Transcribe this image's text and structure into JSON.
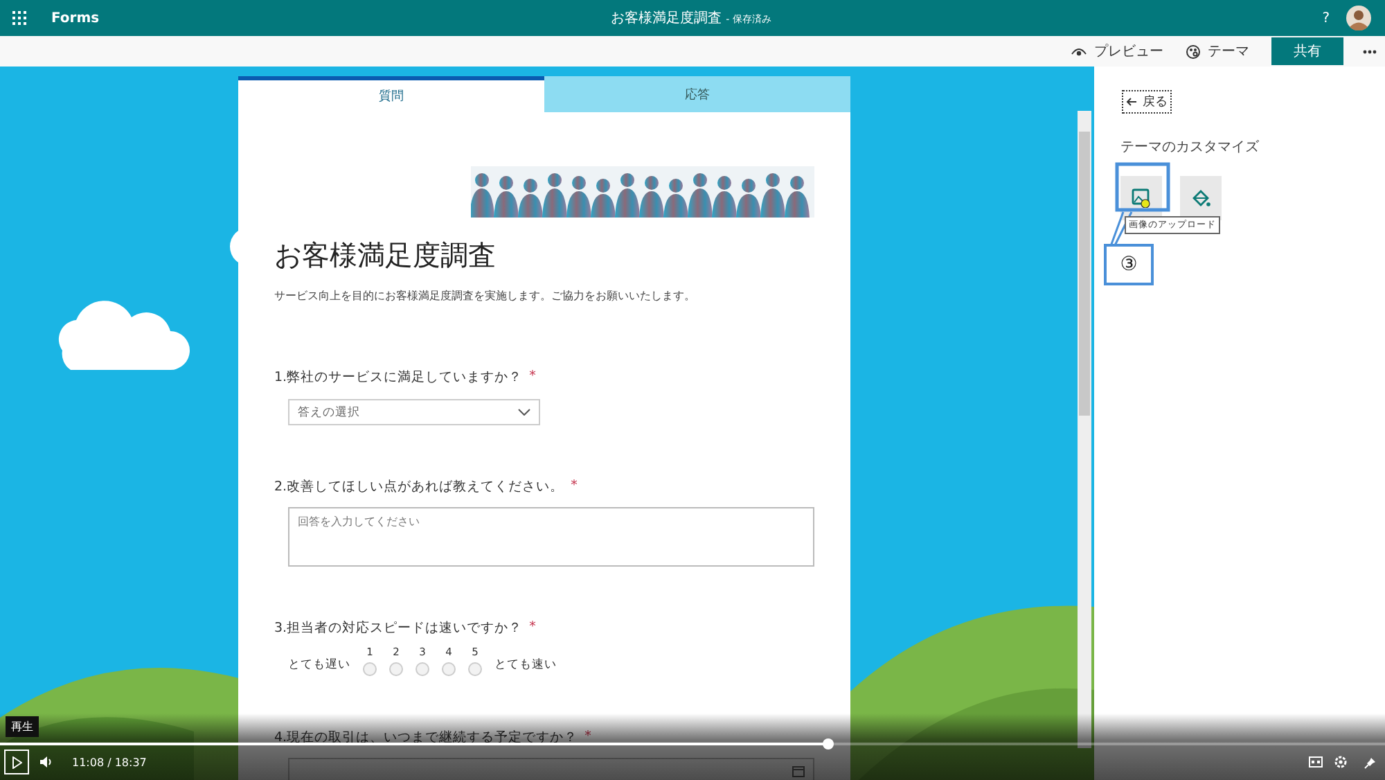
{
  "app_bar": {
    "app_name": "Forms",
    "document_title": "お客様満足度調査",
    "save_status": "- 保存済み",
    "help": "?"
  },
  "toolbar": {
    "buttons": [
      {
        "kind": "preview",
        "label": "プレビュー"
      },
      {
        "kind": "theme",
        "label": "テーマ"
      },
      {
        "kind": "share",
        "label": "共有"
      }
    ]
  },
  "form": {
    "tabs": [
      {
        "label": "質問",
        "selected": true
      },
      {
        "label": "応答",
        "selected": false
      }
    ],
    "title": "お客様満足度調査",
    "description": "サービス向上を目的にお客様満足度調査を実施します。ご協力をお願いいたします。",
    "required_mark": "*",
    "questions": [
      {
        "kind": "choice",
        "text": "1.弊社のサービスに満足していますか？",
        "required": true,
        "placeholder": "答えの選択"
      },
      {
        "kind": "text",
        "text": "2.改善してほしい点があれば教えてください。",
        "required": true,
        "placeholder": "回答を入力してください"
      },
      {
        "kind": "rating",
        "text": "3.担当者の対応スピードは速いですか？",
        "required": true,
        "low_label": "とても遅い",
        "high_label": "とても速い",
        "options": [
          {
            "label": "1",
            "selected": false
          },
          {
            "label": "2",
            "selected": false
          },
          {
            "label": "3",
            "selected": false
          },
          {
            "label": "4",
            "selected": false
          },
          {
            "label": "5",
            "selected": false
          }
        ]
      },
      {
        "kind": "date",
        "text": "4.現在の取引は、いつまで継続する予定ですか？",
        "required": true
      }
    ]
  },
  "theme_panel": {
    "back": "戻る",
    "title": "テーマのカスタマイズ",
    "tiles": [
      {
        "kind": "upload-image"
      },
      {
        "kind": "fill"
      }
    ],
    "tooltip": "画像のアップロード",
    "callout": "③"
  },
  "video_player": {
    "tooltip": "再生",
    "time": "11:08 / 18:37",
    "level": 0.598
  }
}
